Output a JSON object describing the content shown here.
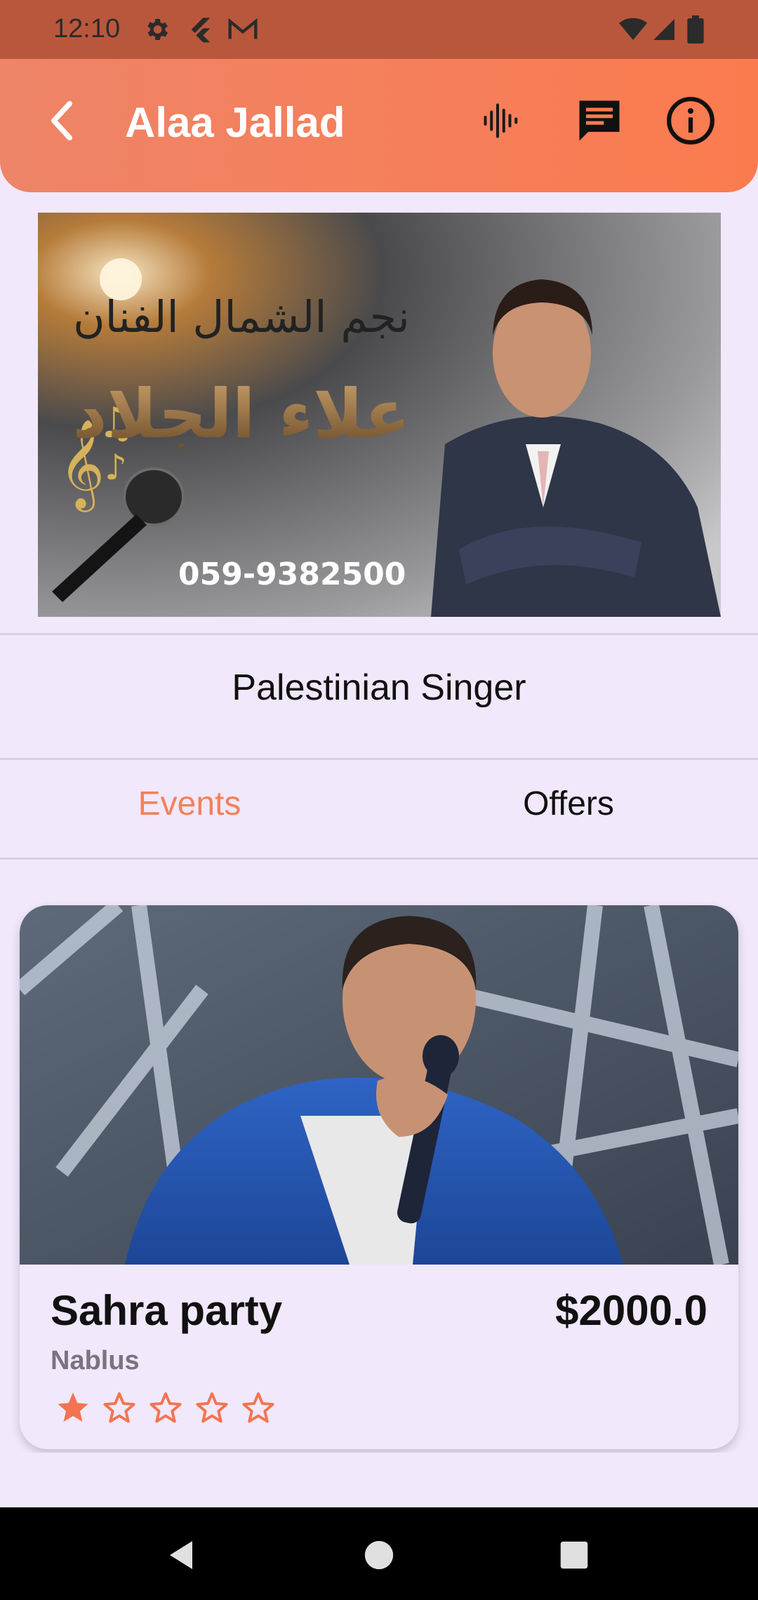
{
  "status_bar": {
    "time": "12:10",
    "icons_left": [
      "gear-icon",
      "flutter-icon",
      "gmail-icon"
    ],
    "icons_right": [
      "wifi-icon",
      "signal-icon",
      "battery-icon"
    ]
  },
  "app_bar": {
    "title": "Alaa Jallad",
    "actions": [
      "audio-wave-icon",
      "message-icon",
      "info-icon"
    ]
  },
  "banner": {
    "headline_ar_1": "نجم الشمال الفنان",
    "headline_ar_2": "علاء الجلاد",
    "phone": "059-9382500"
  },
  "profile": {
    "subtitle": "Palestinian Singer"
  },
  "tabs": [
    {
      "label": "Events",
      "active": true
    },
    {
      "label": "Offers",
      "active": false
    }
  ],
  "event_card": {
    "title": "Sahra party",
    "price": "$2000.0",
    "location": "Nablus",
    "rating": 1,
    "rating_max": 5
  },
  "colors": {
    "status_bar": "#b9573c",
    "accent": "#fb7b4f",
    "background": "#f1e8fc",
    "tab_active": "#f4805a"
  }
}
